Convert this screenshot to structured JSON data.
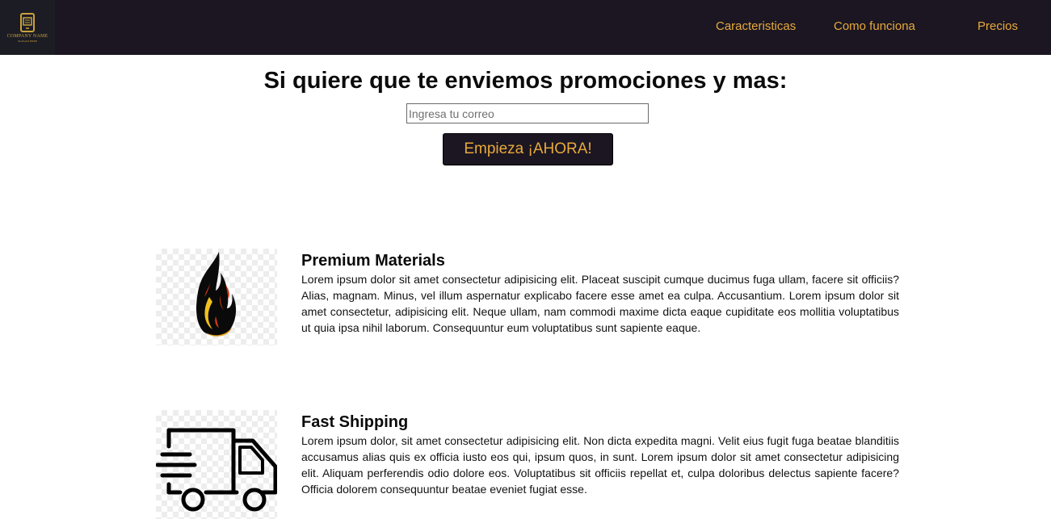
{
  "header": {
    "logo": {
      "name": "COMPANY NAME",
      "slogan": "SLOGAN HERE",
      "icon": "phone-icon"
    },
    "nav": [
      {
        "label": "Caracteristicas"
      },
      {
        "label": "Como funciona"
      },
      {
        "label": "Precios"
      }
    ]
  },
  "promo": {
    "title": "Si quiere que te enviemos promociones y mas:",
    "email_placeholder": "Ingresa tu correo",
    "email_value": "",
    "button_label": "Empieza ¡AHORA!"
  },
  "features": [
    {
      "icon": "flame-icon",
      "title": "Premium Materials",
      "text": "Lorem ipsum dolor sit amet consectetur adipisicing elit. Placeat suscipit cumque ducimus fuga ullam, facere sit officiis? Alias, magnam. Minus, vel illum aspernatur explicabo facere esse amet ea culpa. Accusantium. Lorem ipsum dolor sit amet consectetur, adipisicing elit. Neque ullam, nam commodi maxime dicta eaque cupiditate eos mollitia voluptatibus ut quia ipsa nihil laborum. Consequuntur eum voluptatibus sunt sapiente eaque."
    },
    {
      "icon": "delivery-truck-icon",
      "title": "Fast Shipping",
      "text": "Lorem ipsum dolor, sit amet consectetur adipisicing elit. Non dicta expedita magni. Velit eius fugit fuga beatae blanditiis accusamus alias quis ex officia iusto eos qui, ipsum quos, in sunt. Lorem ipsum dolor sit amet consectetur adipisicing elit. Aliquam perferendis odio dolore eos. Voluptatibus sit officiis repellat et, culpa doloribus delectus sapiente facere? Officia dolorem consequuntur beatae eveniet fugiat esse."
    }
  ],
  "colors": {
    "navbar_bg": "#1b1622",
    "accent": "#e8a93a",
    "text": "#0b0b0b"
  }
}
